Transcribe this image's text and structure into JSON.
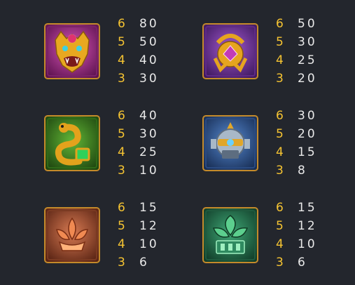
{
  "symbols": [
    {
      "icon": "jaguar-head-icon",
      "colors": {
        "tile": "#b8339a",
        "tile_dark": "#5e1350",
        "emblem": "#e8a820",
        "gem": "#e0336f"
      },
      "payouts": [
        {
          "count": "6",
          "value": "80"
        },
        {
          "count": "5",
          "value": "50"
        },
        {
          "count": "4",
          "value": "40"
        },
        {
          "count": "3",
          "value": "30"
        }
      ]
    },
    {
      "icon": "golden-amulet-icon",
      "colors": {
        "tile": "#8a3fb4",
        "tile_dark": "#3f1960",
        "emblem": "#e6a41f",
        "gem": "#c23bb8"
      },
      "payouts": [
        {
          "count": "6",
          "value": "50"
        },
        {
          "count": "5",
          "value": "30"
        },
        {
          "count": "4",
          "value": "25"
        },
        {
          "count": "3",
          "value": "20"
        }
      ]
    },
    {
      "icon": "serpent-icon",
      "colors": {
        "tile": "#4c9a28",
        "tile_dark": "#1f4710",
        "emblem": "#e3a21c",
        "gem": "#2fd15a"
      },
      "payouts": [
        {
          "count": "6",
          "value": "40"
        },
        {
          "count": "5",
          "value": "30"
        },
        {
          "count": "4",
          "value": "25"
        },
        {
          "count": "3",
          "value": "10"
        }
      ]
    },
    {
      "icon": "sun-mask-icon",
      "colors": {
        "tile": "#3d6db3",
        "tile_dark": "#182e55",
        "emblem": "#a8b8c8",
        "gem": "#e0a62a"
      },
      "payouts": [
        {
          "count": "6",
          "value": "30"
        },
        {
          "count": "5",
          "value": "20"
        },
        {
          "count": "4",
          "value": "15"
        },
        {
          "count": "3",
          "value": "8"
        }
      ]
    },
    {
      "icon": "lotus-flower-icon",
      "colors": {
        "tile": "#c0643f",
        "tile_dark": "#5a2414",
        "emblem": "#f08a52",
        "gem": "#ffb27a"
      },
      "payouts": [
        {
          "count": "6",
          "value": "15"
        },
        {
          "count": "5",
          "value": "12"
        },
        {
          "count": "4",
          "value": "10"
        },
        {
          "count": "3",
          "value": "6"
        }
      ]
    },
    {
      "icon": "jade-leaf-icon",
      "colors": {
        "tile": "#2f8a60",
        "tile_dark": "#113d29",
        "emblem": "#5ccf8e",
        "gem": "#9ff0c0"
      },
      "payouts": [
        {
          "count": "6",
          "value": "15"
        },
        {
          "count": "5",
          "value": "12"
        },
        {
          "count": "4",
          "value": "10"
        },
        {
          "count": "3",
          "value": "6"
        }
      ]
    }
  ]
}
